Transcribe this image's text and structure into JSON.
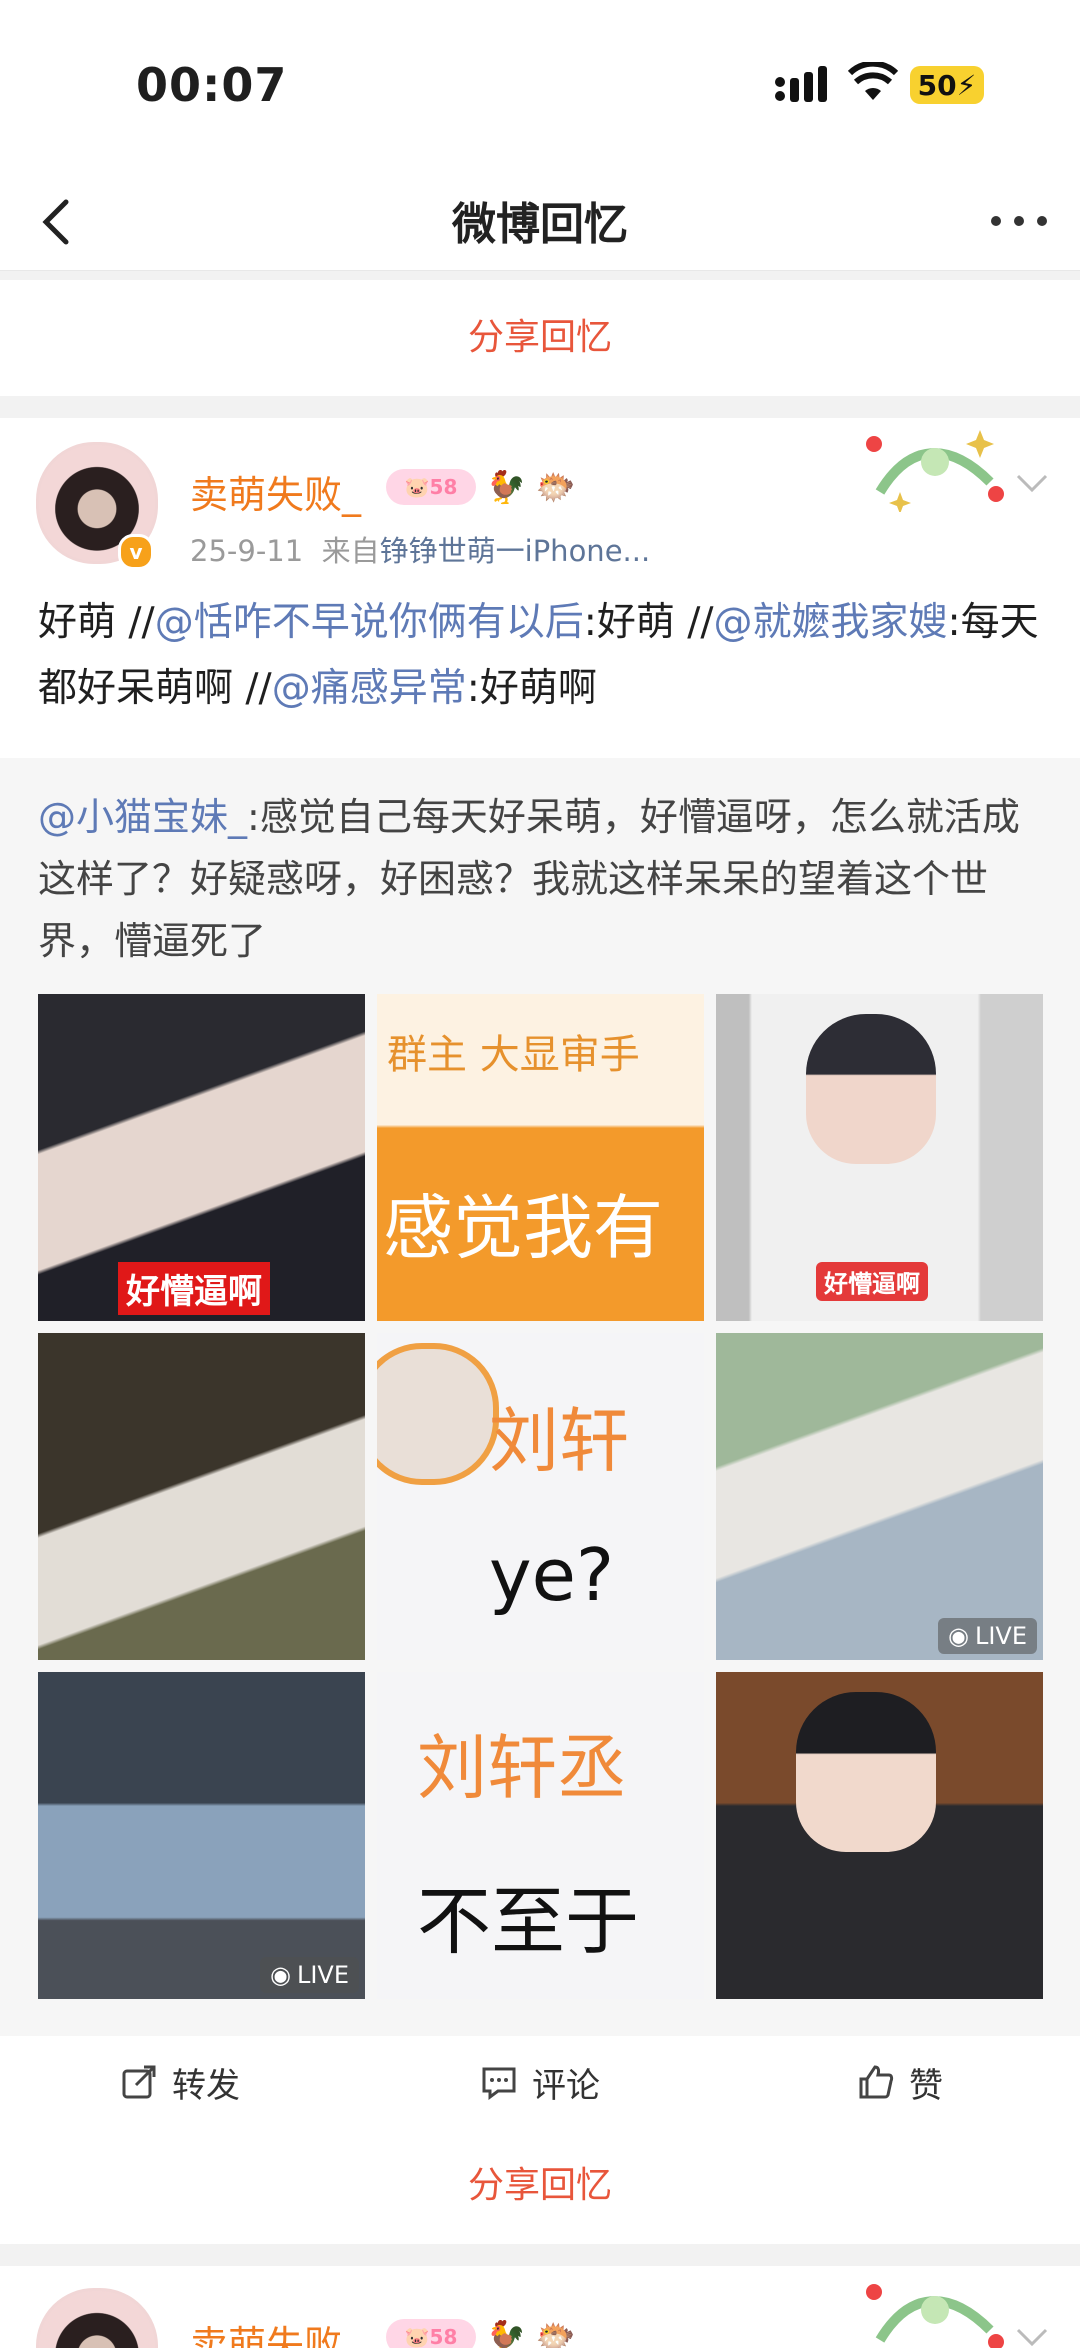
{
  "status": {
    "time": "00:07",
    "battery": "50"
  },
  "nav": {
    "title": "微博回忆"
  },
  "share_label": "分享回忆",
  "post": {
    "author": "卖萌失败_",
    "level_badge": "58",
    "date": "25-9-11",
    "source_prefix": "来自",
    "source": "铮铮世萌一iPhone...",
    "text_parts": [
      {
        "text": "好萌 //",
        "at": false
      },
      {
        "text": "@恬咋不早说你俩有以后",
        "at": true
      },
      {
        "text": ":好萌 //",
        "at": false
      },
      {
        "text": "@就嬷我家嫂",
        "at": true
      },
      {
        "text": ":每天都好呆萌啊 //",
        "at": false
      },
      {
        "text": "@痛感异常",
        "at": true
      },
      {
        "text": ":好萌啊",
        "at": false
      }
    ],
    "quote_author": "@小猫宝妹_",
    "quote_text": ":感觉自己每天好呆萌，好懵逼呀，怎么就活成这样了？好疑惑呀，好困惑？我就这样呆呆的望着这个世界，懵逼死了",
    "images": [
      {
        "caption": "好懵逼啊",
        "live": "",
        "text1": "",
        "text2": ""
      },
      {
        "caption": "",
        "live": "",
        "text1": "群主  大显审手",
        "text2": "感觉我有"
      },
      {
        "caption": "好懵逼啊",
        "live": "",
        "text1": "",
        "text2": ""
      },
      {
        "caption": "",
        "live": "",
        "text1": "",
        "text2": ""
      },
      {
        "caption": "",
        "live": "",
        "text1": "刘轩",
        "text2": "ye?"
      },
      {
        "caption": "",
        "live": "LIVE",
        "text1": "",
        "text2": ""
      },
      {
        "caption": "",
        "live": "LIVE",
        "text1": "",
        "text2": ""
      },
      {
        "caption": "",
        "live": "",
        "text1": "刘轩丞",
        "text2": "不至于"
      },
      {
        "caption": "",
        "live": "",
        "text1": "",
        "text2": ""
      }
    ]
  },
  "actions": {
    "repost": "转发",
    "comment": "评论",
    "like": "赞"
  },
  "next_post": {
    "author": "卖萌失败_",
    "level_badge": "58"
  },
  "colors": {
    "accent": "#e8563b",
    "username": "#f07a1d",
    "mention": "#5e7ab6"
  }
}
